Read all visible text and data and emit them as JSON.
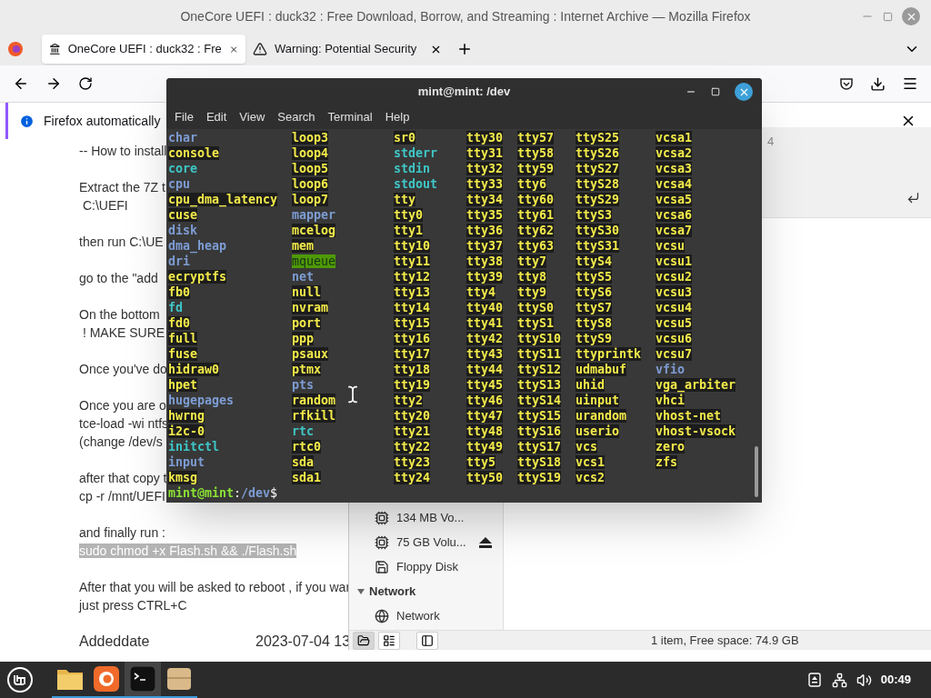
{
  "browser": {
    "window_title": "OneCore UEFI : duck32 : Free Download, Borrow, and Streaming : Internet Archive — Mozilla Firefox",
    "tabs": [
      {
        "label": "OneCore UEFI : duck32 : Fre",
        "kind": "archive",
        "selected": true
      },
      {
        "label": "Warning: Potential Security",
        "kind": "warning",
        "selected": false
      }
    ],
    "notification": {
      "text": "Firefox automatically"
    },
    "paragraphs": [
      [
        {
          "text": "-- How to install",
          "selected": false
        }
      ],
      [
        {
          "text": "Extract the 7Z t",
          "selected": false
        },
        {
          "text": " C:\\UEFI",
          "selected": false
        }
      ],
      [
        {
          "text": "then run C:\\UE",
          "selected": false
        }
      ],
      [
        {
          "text": "go to the \"add",
          "selected": false
        }
      ],
      [
        {
          "text": "On the bottom",
          "selected": false
        },
        {
          "text": " ! MAKE SURE",
          "selected": false
        }
      ],
      [
        {
          "text": "Once you've do",
          "selected": false
        }
      ],
      [
        {
          "text": "Once you are o",
          "selected": false
        },
        {
          "text": "tce-load -wi ntfs",
          "selected": false
        },
        {
          "text": "(change /dev/s",
          "selected": false
        }
      ],
      [
        {
          "text": "after that copy t",
          "selected": false
        },
        {
          "text": "cp -r /mnt/UEFI",
          "selected": false
        }
      ],
      [
        {
          "text": "and finally run :",
          "selected": false
        },
        {
          "text": "sudo chmod +x Flash.sh && ./Flash.sh",
          "selected": true
        }
      ],
      [
        {
          "text": "After that you will be asked to reboot , if you war",
          "selected": false
        },
        {
          "text": "just press CTRL+C",
          "selected": false
        }
      ]
    ],
    "metadata": [
      {
        "label": "Addeddate",
        "value": "2023-07-04 13"
      }
    ]
  },
  "file_manager": {
    "path_fragment": "4",
    "sidebar": [
      {
        "kind": "drive",
        "label": "134 MB Vo...",
        "eject": false
      },
      {
        "kind": "drive",
        "label": "75 GB Volu...",
        "eject": true
      },
      {
        "kind": "floppy",
        "label": "Floppy Disk",
        "eject": false
      },
      {
        "kind": "section",
        "label": "Network",
        "expanded": true
      },
      {
        "kind": "network",
        "label": "Network",
        "eject": false
      }
    ],
    "view_buttons": [
      {
        "kind": "places",
        "selected": true
      },
      {
        "kind": "tree",
        "selected": false
      },
      {
        "kind": "toggle",
        "selected": false
      }
    ],
    "status": "1 item, Free space: 74.9 GB"
  },
  "terminal": {
    "title": "mint@mint: /dev",
    "menu": [
      "File",
      "Edit",
      "View",
      "Search",
      "Terminal",
      "Help"
    ],
    "columns": [
      [
        {
          "name": "char",
          "kind": "dir"
        },
        {
          "name": "console",
          "kind": "dev"
        },
        {
          "name": "core",
          "kind": "link"
        },
        {
          "name": "cpu",
          "kind": "dir"
        },
        {
          "name": "cpu_dma_latency",
          "kind": "dev"
        },
        {
          "name": "cuse",
          "kind": "dev"
        },
        {
          "name": "disk",
          "kind": "dir"
        },
        {
          "name": "dma_heap",
          "kind": "dir"
        },
        {
          "name": "dri",
          "kind": "dir"
        },
        {
          "name": "ecryptfs",
          "kind": "dev"
        },
        {
          "name": "fb0",
          "kind": "dev"
        },
        {
          "name": "fd",
          "kind": "link"
        },
        {
          "name": "fd0",
          "kind": "dev"
        },
        {
          "name": "full",
          "kind": "dev"
        },
        {
          "name": "fuse",
          "kind": "dev"
        },
        {
          "name": "hidraw0",
          "kind": "dev"
        },
        {
          "name": "hpet",
          "kind": "dev"
        },
        {
          "name": "hugepages",
          "kind": "dir"
        },
        {
          "name": "hwrng",
          "kind": "dev"
        },
        {
          "name": "i2c-0",
          "kind": "dev"
        },
        {
          "name": "initctl",
          "kind": "link"
        },
        {
          "name": "input",
          "kind": "dir"
        },
        {
          "name": "kmsg",
          "kind": "dev"
        }
      ],
      [
        {
          "name": "loop3",
          "kind": "dev"
        },
        {
          "name": "loop4",
          "kind": "dev"
        },
        {
          "name": "loop5",
          "kind": "dev"
        },
        {
          "name": "loop6",
          "kind": "dev"
        },
        {
          "name": "loop7",
          "kind": "dev"
        },
        {
          "name": "mapper",
          "kind": "dir"
        },
        {
          "name": "mcelog",
          "kind": "dev"
        },
        {
          "name": "mem",
          "kind": "dev"
        },
        {
          "name": "mqueue",
          "kind": "sticky"
        },
        {
          "name": "net",
          "kind": "dir"
        },
        {
          "name": "null",
          "kind": "dev"
        },
        {
          "name": "nvram",
          "kind": "dev"
        },
        {
          "name": "port",
          "kind": "dev"
        },
        {
          "name": "ppp",
          "kind": "dev"
        },
        {
          "name": "psaux",
          "kind": "dev"
        },
        {
          "name": "ptmx",
          "kind": "dev"
        },
        {
          "name": "pts",
          "kind": "dir"
        },
        {
          "name": "random",
          "kind": "dev"
        },
        {
          "name": "rfkill",
          "kind": "dev"
        },
        {
          "name": "rtc",
          "kind": "link"
        },
        {
          "name": "rtc0",
          "kind": "dev"
        },
        {
          "name": "sda",
          "kind": "dev"
        },
        {
          "name": "sda1",
          "kind": "dev"
        }
      ],
      [
        {
          "name": "sr0",
          "kind": "dev"
        },
        {
          "name": "stderr",
          "kind": "link"
        },
        {
          "name": "stdin",
          "kind": "link"
        },
        {
          "name": "stdout",
          "kind": "link"
        },
        {
          "name": "tty",
          "kind": "dev"
        },
        {
          "name": "tty0",
          "kind": "dev"
        },
        {
          "name": "tty1",
          "kind": "dev"
        },
        {
          "name": "tty10",
          "kind": "dev"
        },
        {
          "name": "tty11",
          "kind": "dev"
        },
        {
          "name": "tty12",
          "kind": "dev"
        },
        {
          "name": "tty13",
          "kind": "dev"
        },
        {
          "name": "tty14",
          "kind": "dev"
        },
        {
          "name": "tty15",
          "kind": "dev"
        },
        {
          "name": "tty16",
          "kind": "dev"
        },
        {
          "name": "tty17",
          "kind": "dev"
        },
        {
          "name": "tty18",
          "kind": "dev"
        },
        {
          "name": "tty19",
          "kind": "dev"
        },
        {
          "name": "tty2",
          "kind": "dev"
        },
        {
          "name": "tty20",
          "kind": "dev"
        },
        {
          "name": "tty21",
          "kind": "dev"
        },
        {
          "name": "tty22",
          "kind": "dev"
        },
        {
          "name": "tty23",
          "kind": "dev"
        },
        {
          "name": "tty24",
          "kind": "dev"
        }
      ],
      [
        {
          "name": "tty30",
          "kind": "dev"
        },
        {
          "name": "tty31",
          "kind": "dev"
        },
        {
          "name": "tty32",
          "kind": "dev"
        },
        {
          "name": "tty33",
          "kind": "dev"
        },
        {
          "name": "tty34",
          "kind": "dev"
        },
        {
          "name": "tty35",
          "kind": "dev"
        },
        {
          "name": "tty36",
          "kind": "dev"
        },
        {
          "name": "tty37",
          "kind": "dev"
        },
        {
          "name": "tty38",
          "kind": "dev"
        },
        {
          "name": "tty39",
          "kind": "dev"
        },
        {
          "name": "tty4",
          "kind": "dev"
        },
        {
          "name": "tty40",
          "kind": "dev"
        },
        {
          "name": "tty41",
          "kind": "dev"
        },
        {
          "name": "tty42",
          "kind": "dev"
        },
        {
          "name": "tty43",
          "kind": "dev"
        },
        {
          "name": "tty44",
          "kind": "dev"
        },
        {
          "name": "tty45",
          "kind": "dev"
        },
        {
          "name": "tty46",
          "kind": "dev"
        },
        {
          "name": "tty47",
          "kind": "dev"
        },
        {
          "name": "tty48",
          "kind": "dev"
        },
        {
          "name": "tty49",
          "kind": "dev"
        },
        {
          "name": "tty5",
          "kind": "dev"
        },
        {
          "name": "tty50",
          "kind": "dev"
        }
      ],
      [
        {
          "name": "tty57",
          "kind": "dev"
        },
        {
          "name": "tty58",
          "kind": "dev"
        },
        {
          "name": "tty59",
          "kind": "dev"
        },
        {
          "name": "tty6",
          "kind": "dev"
        },
        {
          "name": "tty60",
          "kind": "dev"
        },
        {
          "name": "tty61",
          "kind": "dev"
        },
        {
          "name": "tty62",
          "kind": "dev"
        },
        {
          "name": "tty63",
          "kind": "dev"
        },
        {
          "name": "tty7",
          "kind": "dev"
        },
        {
          "name": "tty8",
          "kind": "dev"
        },
        {
          "name": "tty9",
          "kind": "dev"
        },
        {
          "name": "ttyS0",
          "kind": "dev"
        },
        {
          "name": "ttyS1",
          "kind": "dev"
        },
        {
          "name": "ttyS10",
          "kind": "dev"
        },
        {
          "name": "ttyS11",
          "kind": "dev"
        },
        {
          "name": "ttyS12",
          "kind": "dev"
        },
        {
          "name": "ttyS13",
          "kind": "dev"
        },
        {
          "name": "ttyS14",
          "kind": "dev"
        },
        {
          "name": "ttyS15",
          "kind": "dev"
        },
        {
          "name": "ttyS16",
          "kind": "dev"
        },
        {
          "name": "ttyS17",
          "kind": "dev"
        },
        {
          "name": "ttyS18",
          "kind": "dev"
        },
        {
          "name": "ttyS19",
          "kind": "dev"
        }
      ],
      [
        {
          "name": "ttyS25",
          "kind": "dev"
        },
        {
          "name": "ttyS26",
          "kind": "dev"
        },
        {
          "name": "ttyS27",
          "kind": "dev"
        },
        {
          "name": "ttyS28",
          "kind": "dev"
        },
        {
          "name": "ttyS29",
          "kind": "dev"
        },
        {
          "name": "ttyS3",
          "kind": "dev"
        },
        {
          "name": "ttyS30",
          "kind": "dev"
        },
        {
          "name": "ttyS31",
          "kind": "dev"
        },
        {
          "name": "ttyS4",
          "kind": "dev"
        },
        {
          "name": "ttyS5",
          "kind": "dev"
        },
        {
          "name": "ttyS6",
          "kind": "dev"
        },
        {
          "name": "ttyS7",
          "kind": "dev"
        },
        {
          "name": "ttyS8",
          "kind": "dev"
        },
        {
          "name": "ttyS9",
          "kind": "dev"
        },
        {
          "name": "ttyprintk",
          "kind": "dev"
        },
        {
          "name": "udmabuf",
          "kind": "dev"
        },
        {
          "name": "uhid",
          "kind": "dev"
        },
        {
          "name": "uinput",
          "kind": "dev"
        },
        {
          "name": "urandom",
          "kind": "dev"
        },
        {
          "name": "userio",
          "kind": "dev"
        },
        {
          "name": "vcs",
          "kind": "dev"
        },
        {
          "name": "vcs1",
          "kind": "dev"
        },
        {
          "name": "vcs2",
          "kind": "dev"
        }
      ],
      [
        {
          "name": "vcsa1",
          "kind": "dev"
        },
        {
          "name": "vcsa2",
          "kind": "dev"
        },
        {
          "name": "vcsa3",
          "kind": "dev"
        },
        {
          "name": "vcsa4",
          "kind": "dev"
        },
        {
          "name": "vcsa5",
          "kind": "dev"
        },
        {
          "name": "vcsa6",
          "kind": "dev"
        },
        {
          "name": "vcsa7",
          "kind": "dev"
        },
        {
          "name": "vcsu",
          "kind": "dev"
        },
        {
          "name": "vcsu1",
          "kind": "dev"
        },
        {
          "name": "vcsu2",
          "kind": "dev"
        },
        {
          "name": "vcsu3",
          "kind": "dev"
        },
        {
          "name": "vcsu4",
          "kind": "dev"
        },
        {
          "name": "vcsu5",
          "kind": "dev"
        },
        {
          "name": "vcsu6",
          "kind": "dev"
        },
        {
          "name": "vcsu7",
          "kind": "dev"
        },
        {
          "name": "vfio",
          "kind": "dir"
        },
        {
          "name": "vga_arbiter",
          "kind": "dev"
        },
        {
          "name": "vhci",
          "kind": "dev"
        },
        {
          "name": "vhost-net",
          "kind": "dev"
        },
        {
          "name": "vhost-vsock",
          "kind": "dev"
        },
        {
          "name": "zero",
          "kind": "dev"
        },
        {
          "name": "zfs",
          "kind": "dev"
        }
      ]
    ],
    "prompt": {
      "user_host": "mint@mint",
      "separator": ":",
      "path": "/dev",
      "symbol": "$"
    }
  },
  "taskbar": {
    "apps": [
      {
        "kind": "files",
        "selected": false
      },
      {
        "kind": "firefox",
        "selected": false
      },
      {
        "kind": "terminal",
        "selected": true
      },
      {
        "kind": "archive",
        "selected": false
      }
    ],
    "clock": "00:49"
  }
}
